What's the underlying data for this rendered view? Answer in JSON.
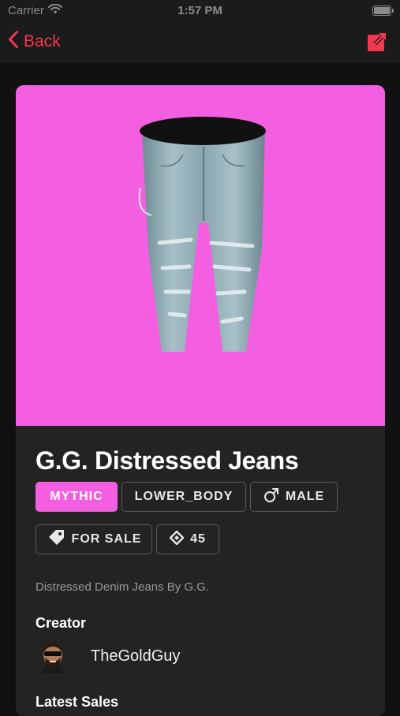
{
  "status_bar": {
    "carrier": "Carrier",
    "time": "1:57 PM"
  },
  "nav": {
    "back_label": "Back",
    "share_icon": "share-external-icon",
    "accent": "#f0394d"
  },
  "item": {
    "hero_background": "#f45fe2",
    "name": "G.G. Distressed Jeans",
    "tags": {
      "rarity": "MYTHIC",
      "body_part": "LOWER_BODY",
      "gender": "MALE",
      "sale_status": "FOR SALE",
      "price": "45"
    },
    "description": "Distressed Denim Jeans By G.G."
  },
  "creator": {
    "heading": "Creator",
    "name": "TheGoldGuy"
  },
  "sales": {
    "heading": "Latest Sales"
  }
}
